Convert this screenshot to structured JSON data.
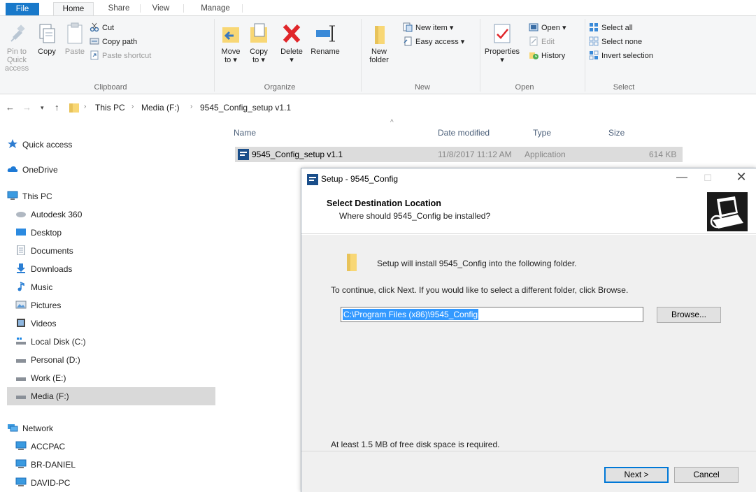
{
  "ribbon_tabs": [
    "File",
    "Home",
    "Share",
    "View",
    "Manage"
  ],
  "clipboard": {
    "pin": "Pin to Quick access",
    "copy": "Copy",
    "paste": "Paste",
    "cut": "Cut",
    "copy_path": "Copy path",
    "paste_shortcut": "Paste shortcut",
    "label": "Clipboard"
  },
  "organize": {
    "move_to": "Move to",
    "copy_to": "Copy to",
    "delete": "Delete",
    "rename": "Rename",
    "label": "Organize"
  },
  "new_group": {
    "new_folder": "New folder",
    "new_item": "New item",
    "easy_access": "Easy access",
    "label": "New"
  },
  "open_group": {
    "properties": "Properties",
    "open": "Open",
    "edit": "Edit",
    "history": "History",
    "label": "Open"
  },
  "select_group": {
    "select_all": "Select all",
    "select_none": "Select none",
    "invert_selection": "Invert selection",
    "label": "Select"
  },
  "breadcrumb": [
    "This PC",
    "Media (F:)",
    "9545_Config_setup v1.1"
  ],
  "sidebar": {
    "items": [
      "Quick access",
      "OneDrive",
      "This PC",
      "Autodesk 360",
      "Desktop",
      "Documents",
      "Downloads",
      "Music",
      "Pictures",
      "Videos",
      "Local Disk (C:)",
      "Personal (D:)",
      "Work (E:)",
      "Media (F:)",
      "Network",
      "ACCPAC",
      "BR-DANIEL",
      "DAVID-PC"
    ]
  },
  "columns": {
    "name": "Name",
    "date": "Date modified",
    "type": "Type",
    "size": "Size"
  },
  "file": {
    "name": "9545_Config_setup v1.1",
    "date": "11/8/2017 11:12 AM",
    "type": "Application",
    "size": "614 KB"
  },
  "dialog": {
    "title": "Setup - 9545_Config",
    "heading": "Select Destination Location",
    "subheading": "Where should 9545_Config be installed?",
    "install_line": "Setup will install 9545_Config into the following folder.",
    "continue_line": "To continue, click Next. If you would like to select a different folder, click Browse.",
    "path": "C:\\Program Files (x86)\\9545_Config",
    "browse": "Browse...",
    "space_line": "At least 1.5 MB of free disk space is required.",
    "next": "Next >",
    "cancel": "Cancel"
  },
  "colors": {
    "file_tab": "#1979ca",
    "selection": "#3399ff",
    "primary_border": "#0078d7"
  }
}
